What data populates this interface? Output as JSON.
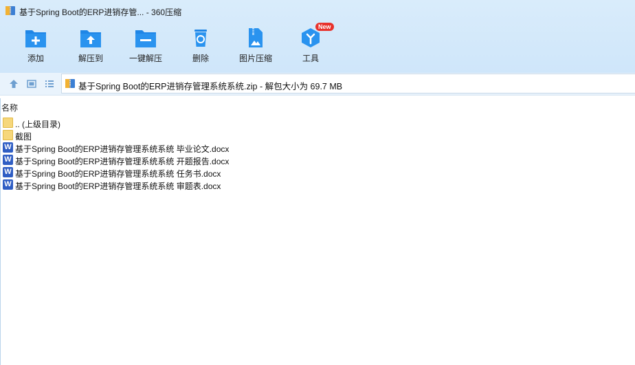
{
  "window": {
    "title": "基于Spring Boot的ERP进销存管... - 360压缩"
  },
  "toolbar": {
    "items": [
      {
        "label": "添加",
        "icon": "folder-add-icon"
      },
      {
        "label": "解压到",
        "icon": "folder-extract-icon"
      },
      {
        "label": "一键解压",
        "icon": "one-click-extract-icon"
      },
      {
        "label": "删除",
        "icon": "recycle-bin-icon"
      },
      {
        "label": "图片压缩",
        "icon": "image-zip-icon"
      },
      {
        "label": "工具",
        "icon": "tools-cube-icon",
        "badge": "New"
      }
    ]
  },
  "address": {
    "path": "基于Spring Boot的ERP进销存管理系统系统.zip - 解包大小为 69.7 MB"
  },
  "list": {
    "column_name": "名称",
    "rows": [
      {
        "name": ".. (上级目录)",
        "type": "folder"
      },
      {
        "name": "截图",
        "type": "folder"
      },
      {
        "name": "基于Spring Boot的ERP进销存管理系统系统 毕业论文.docx",
        "type": "docx"
      },
      {
        "name": "基于Spring Boot的ERP进销存管理系统系统 开题报告.docx",
        "type": "docx"
      },
      {
        "name": "基于Spring Boot的ERP进销存管理系统系统 任务书.docx",
        "type": "docx"
      },
      {
        "name": "基于Spring Boot的ERP进销存管理系统系统 审题表.docx",
        "type": "docx"
      }
    ]
  },
  "colors": {
    "accent": "#1e88e5",
    "header_bg": "#d9ecfb",
    "badge": "#e8322c"
  }
}
